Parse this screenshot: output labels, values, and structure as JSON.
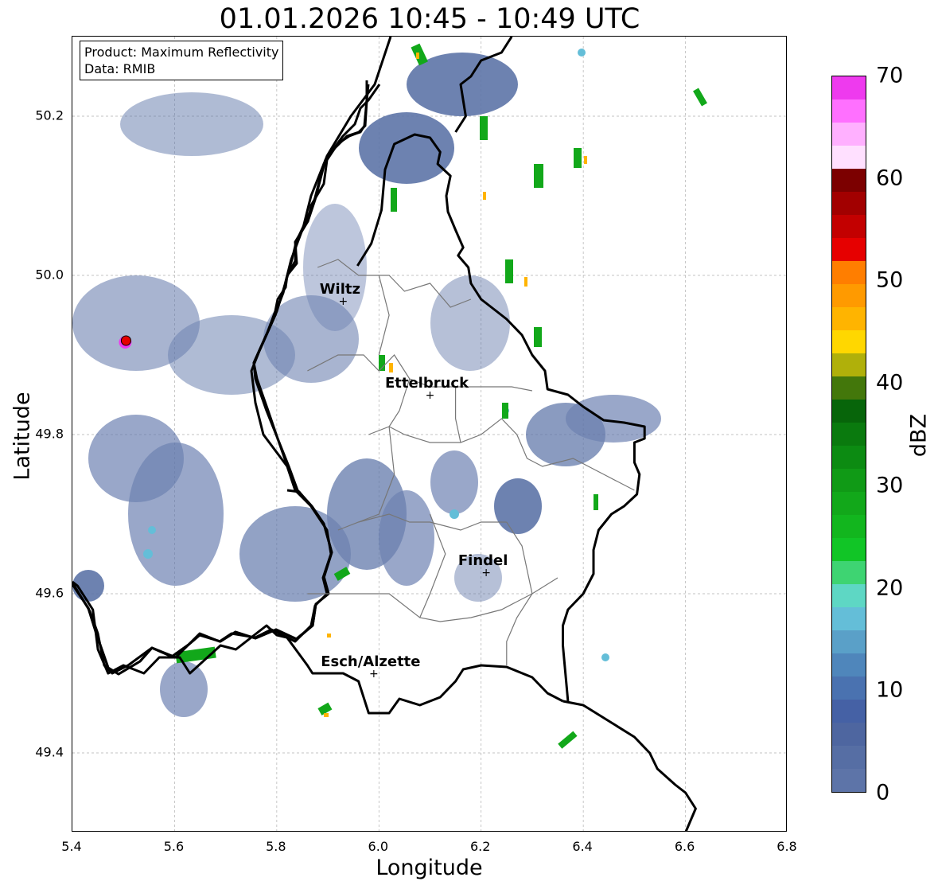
{
  "title": "01.01.2026 10:45 - 10:49 UTC",
  "info": {
    "product": "Product: Maximum Reflectivity",
    "source": "Data: RMIB"
  },
  "axes": {
    "xlabel": "Longitude",
    "ylabel": "Latitude",
    "xlim": [
      5.4,
      6.8
    ],
    "ylim": [
      49.3,
      50.3
    ],
    "xticks": [
      "5.4",
      "5.6",
      "5.8",
      "6.0",
      "6.2",
      "6.4",
      "6.6",
      "6.8"
    ],
    "yticks": [
      "49.4",
      "49.6",
      "49.8",
      "50.0",
      "50.2"
    ],
    "grid": true
  },
  "colorbar": {
    "label": "dBZ",
    "min": 0,
    "max": 70,
    "ticks": [
      "0",
      "10",
      "20",
      "30",
      "40",
      "50",
      "60",
      "70"
    ],
    "colors": [
      "#5d74a8",
      "#566ea4",
      "#4e66a0",
      "#4561a5",
      "#4a72b0",
      "#4f86bb",
      "#5aa0c8",
      "#64bed8",
      "#5ed7c4",
      "#3ed472",
      "#11c526",
      "#12b61e",
      "#12a81a",
      "#109a16",
      "#0c8b12",
      "#0a7a0e",
      "#07650a",
      "#43770b",
      "#b0b00a",
      "#ffd700",
      "#ffb400",
      "#ff9a00",
      "#ff7e00",
      "#e60000",
      "#c30000",
      "#a20000",
      "#7c0000",
      "#ffe0ff",
      "#ffb0ff",
      "#ff70ff",
      "#ee3aee"
    ]
  },
  "cities": [
    {
      "name": "Wiltz",
      "lon": 5.93,
      "lat": 49.968
    },
    {
      "name": "Ettelbruck",
      "lon": 6.1,
      "lat": 49.85
    },
    {
      "name": "Findel",
      "lon": 6.21,
      "lat": 49.627
    },
    {
      "name": "Esch/Alzette",
      "lon": 5.99,
      "lat": 49.5
    }
  ],
  "marker": {
    "lon": 5.505,
    "lat": 49.918,
    "color": "#e60000"
  }
}
